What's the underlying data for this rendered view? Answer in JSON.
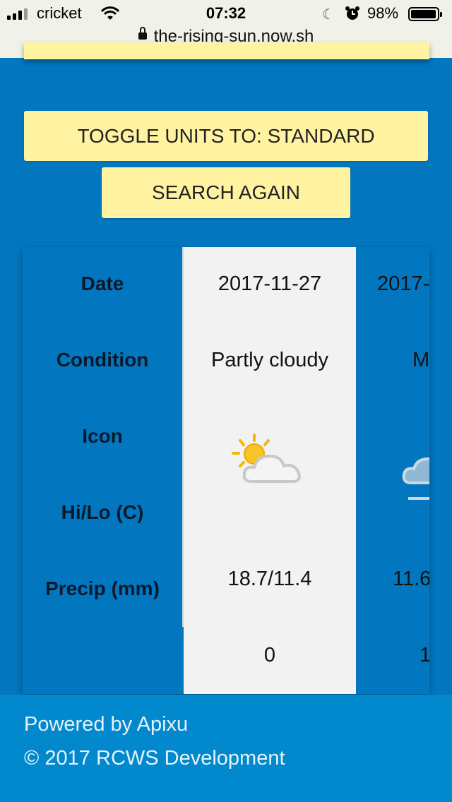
{
  "status_bar": {
    "carrier": "cricket",
    "time": "07:32",
    "battery_percent": "98%"
  },
  "browser": {
    "url": "the-rising-sun.now.sh"
  },
  "buttons": {
    "toggle_units": "TOGGLE UNITS TO: STANDARD",
    "search_again": "SEARCH AGAIN"
  },
  "table": {
    "row_labels": [
      "Date",
      "Condition",
      "Icon",
      "Hi/Lo (C)",
      "Precip (mm)"
    ],
    "days": [
      {
        "date": "2017-11-27",
        "condition": "Partly cloudy",
        "icon": "partly-cloudy-icon",
        "hilo": "18.7/11.4",
        "precip": "0"
      },
      {
        "date": "2017-",
        "condition": "M",
        "icon": "mist-cloud-icon",
        "hilo": "11.6",
        "precip": "1"
      }
    ]
  },
  "footer": {
    "powered_by": "Powered by Apixu",
    "copyright": "© 2017 RCWS Development"
  },
  "colors": {
    "background": "#0277c0",
    "button_yellow": "#fff3a2",
    "footer": "#0288cc"
  }
}
